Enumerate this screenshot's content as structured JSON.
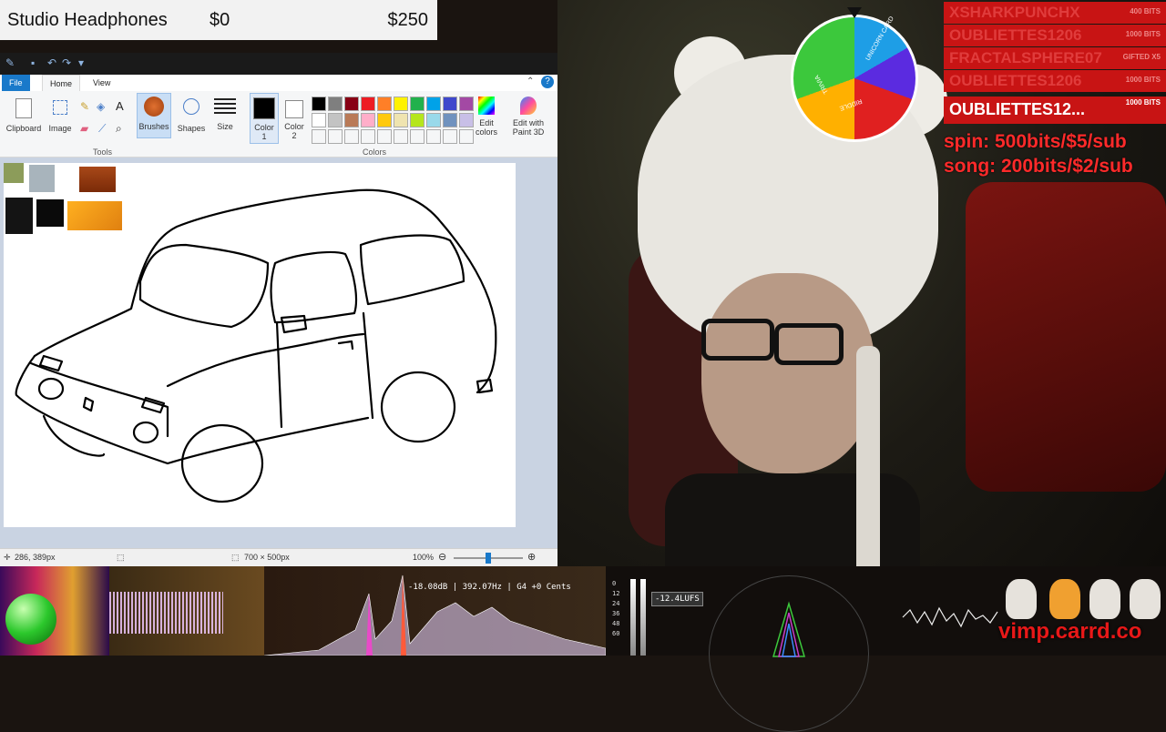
{
  "price_bar": {
    "title": "Studio Headphones",
    "current": "$0",
    "goal": "$250"
  },
  "paint": {
    "menu": {
      "file": "File",
      "home": "Home",
      "view": "View"
    },
    "ribbon": {
      "clipboard": "Clipboard",
      "image": "Image",
      "tools_group": "Tools",
      "brushes": "Brushes",
      "shapes": "Shapes",
      "size": "Size",
      "color1": "Color\n1",
      "color2": "Color\n2",
      "colors_group": "Colors",
      "edit_colors": "Edit\ncolors",
      "edit_paint3d": "Edit with\nPaint 3D"
    },
    "palette": [
      "#000000",
      "#7f7f7f",
      "#880015",
      "#ed1c24",
      "#ff7f27",
      "#fff200",
      "#22b14c",
      "#00a2e8",
      "#3f48cc",
      "#a349a4",
      "#ffffff",
      "#c3c3c3",
      "#b97a57",
      "#ffaec9",
      "#ffc90e",
      "#efe4b0",
      "#b5e61d",
      "#99d9ea",
      "#7092be",
      "#c8bfe7"
    ],
    "status": {
      "cursor_pos": "286, 389px",
      "canvas_size": "700 × 500px",
      "zoom": "100%"
    }
  },
  "wheel": {
    "words": [
      "UNICORN CARD",
      "TRIVIA",
      "RIDDLE"
    ]
  },
  "donors": [
    {
      "name": "XSHARKPUNCHX",
      "amount": "400 BITS"
    },
    {
      "name": "OUBLIETTES1206",
      "amount": "1000 BITS"
    },
    {
      "name": "FRACTALSPHERE07",
      "amount": "GIFTED X5"
    },
    {
      "name": "OUBLIETTES1206",
      "amount": "1000 BITS"
    },
    {
      "name": "OUBLIETTES12...",
      "amount": "1000 BITS"
    }
  ],
  "rules": {
    "spin": "spin: 500bits/$5/sub",
    "song": "song: 200bits/$2/sub"
  },
  "audio": {
    "readout": "-18.08dB | 392.07Hz | G4  +0  Cents",
    "lufs": "-12.4LUFS",
    "meter_scale": "0\n12\n24\n36\n48\n60"
  },
  "brand": "vimp.carrd.co"
}
